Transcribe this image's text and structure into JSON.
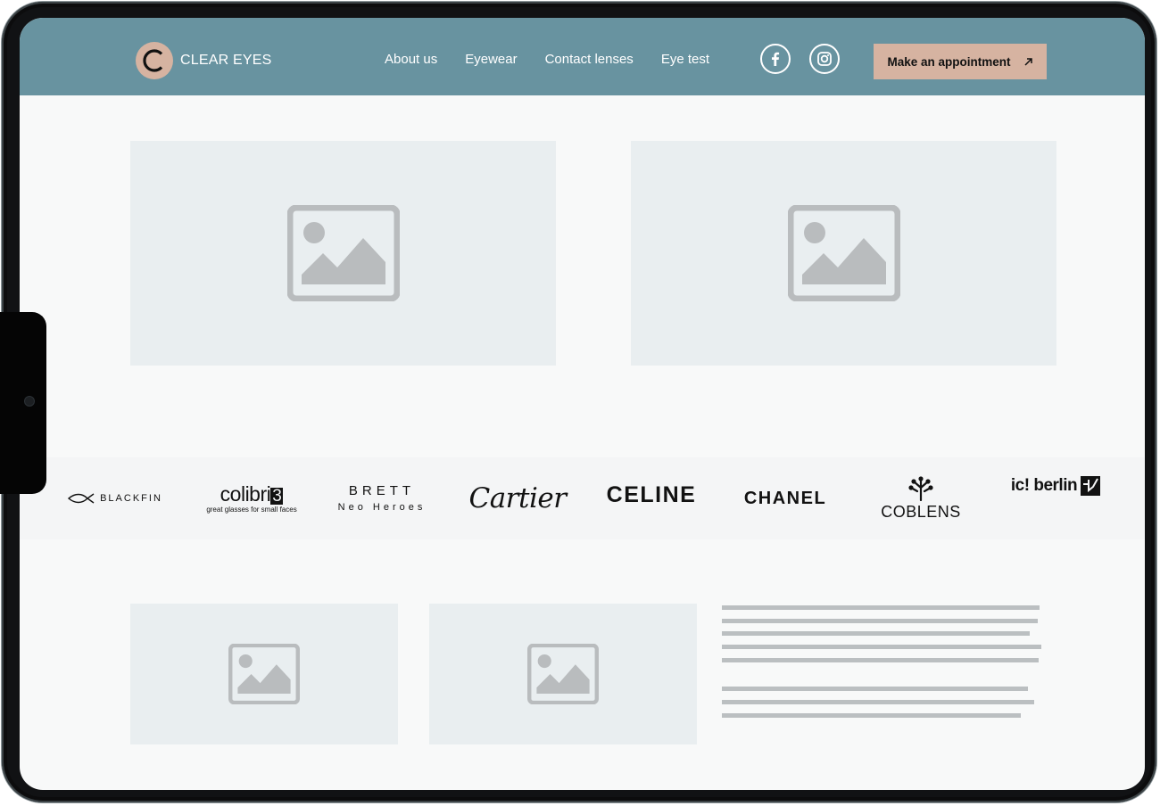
{
  "header": {
    "logo": {
      "letter": "C",
      "text": "CLEAR EYES"
    },
    "nav": [
      {
        "label": "About us"
      },
      {
        "label": "Eyewear"
      },
      {
        "label": "Contact lenses"
      },
      {
        "label": "Eye test"
      }
    ],
    "social": [
      {
        "icon": "facebook-icon"
      },
      {
        "icon": "instagram-icon"
      }
    ],
    "cta": {
      "label": "Make an appointment",
      "icon": "arrow-up-right-icon"
    }
  },
  "hero_images": [
    {
      "icon": "image-placeholder-icon"
    },
    {
      "icon": "image-placeholder-icon"
    }
  ],
  "brands": [
    {
      "name": "BLACKFIN"
    },
    {
      "name": "colibri",
      "badge": "3",
      "tagline": "great glasses for small faces"
    },
    {
      "name": "BRETT",
      "tagline": "Neo Heroes"
    },
    {
      "name": "Cartier"
    },
    {
      "name": "CELINE"
    },
    {
      "name": "CHANEL"
    },
    {
      "name": "COBLENS"
    },
    {
      "name": "ic! berlin"
    }
  ],
  "content_images": [
    {
      "icon": "image-placeholder-icon"
    },
    {
      "icon": "image-placeholder-icon"
    }
  ],
  "colors": {
    "header_bg": "#6893a0",
    "accent": "#d6b3a1",
    "placeholder_bg": "#e9eef0",
    "placeholder_icon": "#b9bcbe",
    "text_line": "#bbbfc1",
    "page_bg": "#f8f9f9"
  }
}
